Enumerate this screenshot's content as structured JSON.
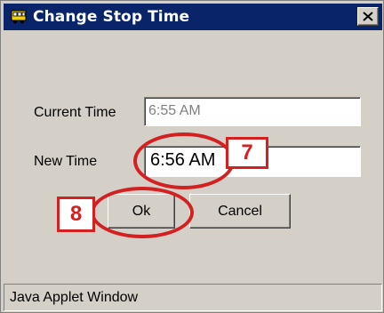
{
  "window": {
    "title": "Change Stop Time",
    "titlebar_color": "#0a246a",
    "icon": "bus-icon",
    "close_icon": "close-icon"
  },
  "form": {
    "current_time_label": "Current Time",
    "current_time_value": "6:55 AM",
    "new_time_label": "New Time",
    "new_time_value": "6:56 AM"
  },
  "buttons": {
    "ok_label": "Ok",
    "cancel_label": "Cancel"
  },
  "annotations": {
    "step_7": "7",
    "step_8": "8",
    "color": "#d32020"
  },
  "statusbar": {
    "text": "Java Applet Window"
  }
}
